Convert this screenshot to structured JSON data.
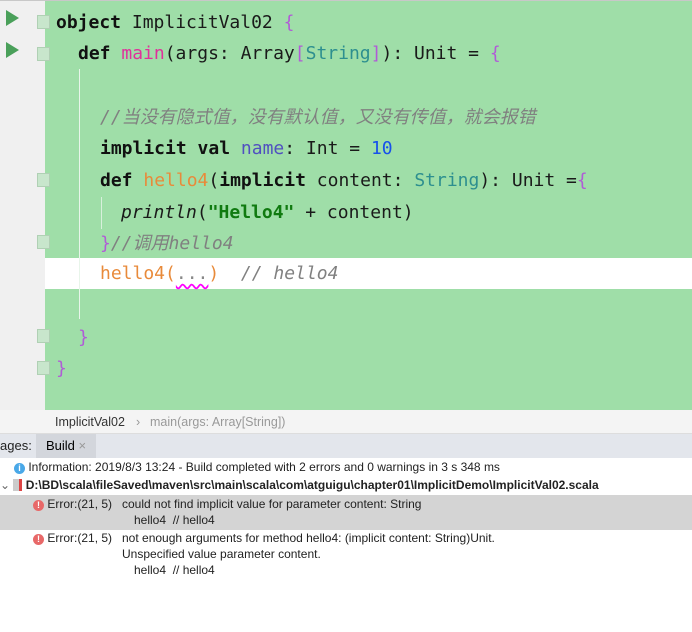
{
  "editor": {
    "l1": {
      "kw": "object",
      "name": " ImplicitVal02 ",
      "brace": "{"
    },
    "l2": {
      "kw": "def",
      "sp": " ",
      "fn": "main",
      "p1": "(args: Array",
      "b1": "[",
      "ty": "String",
      "b2": "]",
      "p2": "): Unit = ",
      "brace": "{"
    },
    "l4": {
      "comment": "//当没有隐式值，没有默认值，又没有传值，就会报错"
    },
    "l5": {
      "kw": "implicit val",
      "sp": " ",
      "fld": "name",
      "p": ": Int = ",
      "num": "10"
    },
    "l6": {
      "kw": "def",
      "sp": " ",
      "fn": "hello4",
      "p1": "(",
      "kw2": "implicit",
      "p2": " content: ",
      "ty": "String",
      "p3": "): Unit =",
      "brace": "{"
    },
    "l7": {
      "fn": "println",
      "p1": "(",
      "str": "\"Hello4\"",
      "p2": " + content)"
    },
    "l8": {
      "brace": "}",
      "comment": "//调用hello4"
    },
    "l9": {
      "fn": "hello4",
      "p1": "(",
      "hint": "...",
      "p2": ")",
      "sp": "  ",
      "comment": "// hello4"
    },
    "l11": {
      "brace": "}"
    },
    "l12": {
      "brace": "}"
    }
  },
  "breadcrumb": {
    "items": [
      "ImplicitVal02",
      "main(args: Array[String])"
    ],
    "sep": "›"
  },
  "panel": {
    "label": "ages:",
    "tab": "Build",
    "close": "×"
  },
  "messages": {
    "info": "Information: 2019/8/3 13:24 - Build completed with 2 errors and 0 warnings in 3 s 348 ms",
    "file": "D:\\BD\\scala\\fileSaved\\maven\\src\\main\\scala\\com\\atguigu\\chapter01\\ImplicitDemo\\ImplicitVal02.scala",
    "errors": [
      {
        "loc": "Error:(21, 5)",
        "text": "could not find implicit value for parameter content: String",
        "code": "hello4  // hello4"
      },
      {
        "loc": "Error:(21, 5)",
        "text": "not enough arguments for method hello4: (implicit content: String)Unit.",
        "text2": "Unspecified value parameter content.",
        "code": "hello4  // hello4"
      }
    ]
  }
}
